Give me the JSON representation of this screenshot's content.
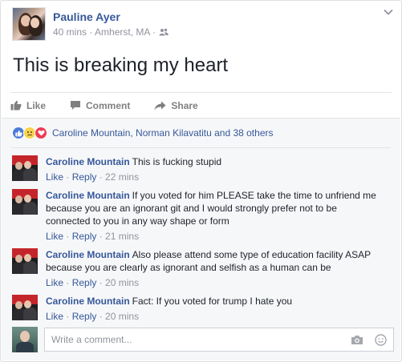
{
  "post": {
    "author": "Pauline Ayer",
    "meta": "40 mins · Amherst, MA ·",
    "text": "This is breaking my heart"
  },
  "actions": {
    "like": "Like",
    "comment": "Comment",
    "share": "Share"
  },
  "reactions": {
    "names": "Caroline Mountain, Norman Kilavatitu",
    "others": " and 38 others"
  },
  "comments": [
    {
      "name": "Caroline Mountain",
      "text": "This is fucking stupid",
      "like": "Like",
      "reply": "Reply",
      "time": "· 22 mins"
    },
    {
      "name": "Caroline Mountain",
      "text": "If you voted for him PLEASE take the time to unfriend me because you are an ignorant git and I would strongly prefer not to be connected to you in any way shape or form",
      "like": "Like",
      "reply": "Reply",
      "time": "· 21 mins"
    },
    {
      "name": "Caroline Mountain",
      "text": "Also please attend some type of education facility ASAP because you are clearly as ignorant and selfish as a human can be",
      "like": "Like",
      "reply": "Reply",
      "time": "· 20 mins"
    },
    {
      "name": "Caroline Mountain",
      "text": "Fact: If you voted for trump I hate you",
      "like": "Like",
      "reply": "Reply",
      "time": "· 20 mins"
    }
  ],
  "write_comment": {
    "placeholder": "Write a comment..."
  },
  "icons": {
    "menu": "chevron-down-icon",
    "audience": "friends-icon",
    "like": "thumbs-up-icon",
    "comment": "speech-bubble-icon",
    "share": "share-arrow-icon",
    "camera": "camera-icon",
    "emoji": "smiley-icon"
  },
  "colors": {
    "link": "#365899",
    "muted": "#90949c",
    "like_reaction": "#4c7bd9",
    "sad_reaction": "#f7d44e",
    "love_reaction": "#ee3b51"
  }
}
